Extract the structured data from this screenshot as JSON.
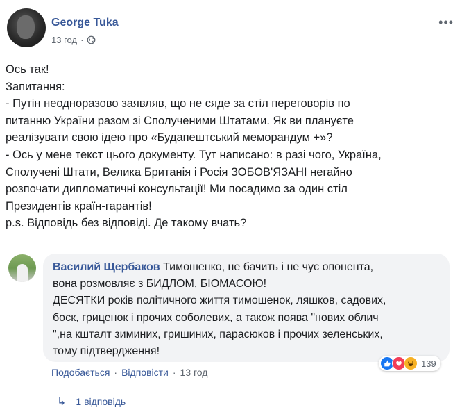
{
  "post": {
    "author": "George Tuka",
    "time": "13 год",
    "separator": "·",
    "more_label": "•••",
    "lines": [
      "Ось так!",
      "Запитання:",
      "- Путін неодноразово заявляв, що не сяде за стіл переговорів по",
      "питанню України разом зі Сполученими Штатами. Як ви плануєте",
      "реалізувати свою ідею про «Будапештський меморандум +»?",
      "- Ось у мене текст цього документу. Тут написано: в разі чого, Україна,",
      "Сполучені Штати, Велика Британія і Росія ЗОБОВ'ЯЗАНІ негайно",
      "розпочати дипломатичні консультації! Ми посадимо за один стіл",
      "Президентів країн-гарантів!",
      "p.s. Відповідь без відповіді. Де такому вчать?"
    ]
  },
  "comment": {
    "author": "Василий Щербаков",
    "first_line": " Тимошенко, не бачить і не чує опонента,",
    "lines": [
      "вона розмовляє з БИДЛОМ, БІОМАСОЮ!",
      "ДЕСЯТКИ років політичного життя тимошенок, ляшков, садових,",
      "боєк, гриценок і прочих соболевих, а також поява \"нових облич",
      "\",на кшталт зиминих, гришиних, парасюков і прочих зеленських,",
      "тому підтвердження!"
    ],
    "reaction_count": "139",
    "actions": {
      "like": "Подобається",
      "reply": "Відповісти",
      "time": "13 год",
      "dot": "·"
    },
    "replies_label": "1 відповідь",
    "reply_arrow": "↳"
  }
}
